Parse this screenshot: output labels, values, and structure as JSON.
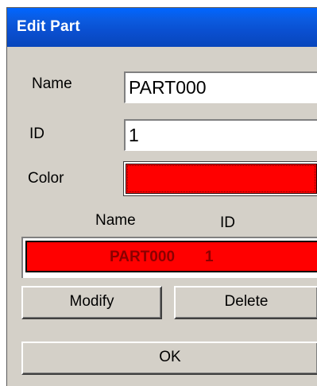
{
  "dialog": {
    "title": "Edit Part"
  },
  "form": {
    "name_label": "Name",
    "name_value": "PART000",
    "id_label": "ID",
    "id_value": "1",
    "color_label": "Color",
    "color_value": "#ff0000"
  },
  "list": {
    "col_name": "Name",
    "col_id": "ID",
    "rows": [
      {
        "name": "PART000",
        "id": "1",
        "color": "#ff0000"
      }
    ]
  },
  "buttons": {
    "modify": "Modify",
    "delete": "Delete",
    "ok": "OK"
  }
}
